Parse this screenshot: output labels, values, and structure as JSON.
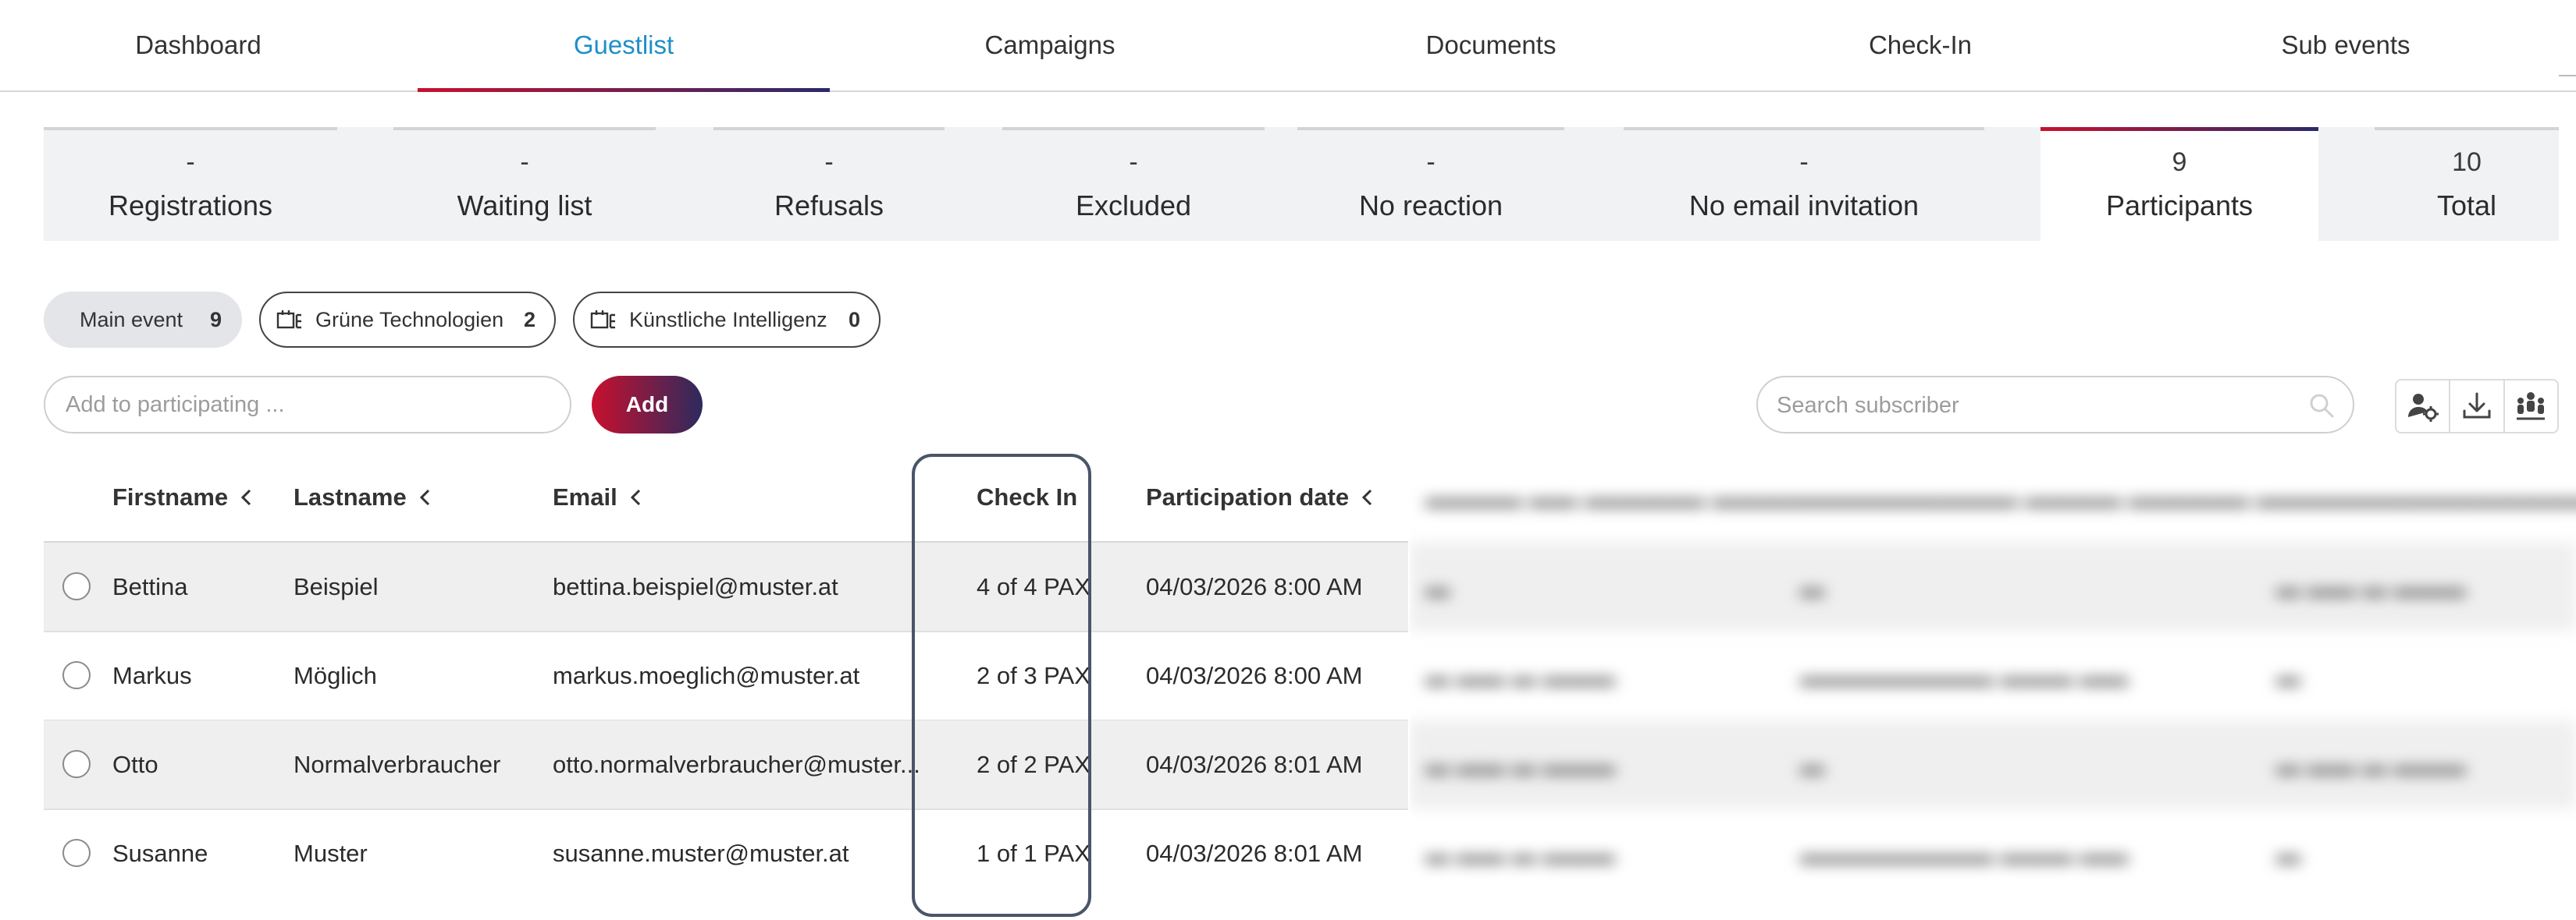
{
  "nav": {
    "tabs": [
      {
        "label": "Dashboard"
      },
      {
        "label": "Guestlist",
        "active": true
      },
      {
        "label": "Campaigns"
      },
      {
        "label": "Documents"
      },
      {
        "label": "Check-In"
      },
      {
        "label": "Sub events"
      }
    ]
  },
  "status_tabs": [
    {
      "count": "-",
      "label": "Registrations"
    },
    {
      "count": "-",
      "label": "Waiting list"
    },
    {
      "count": "-",
      "label": "Refusals"
    },
    {
      "count": "-",
      "label": "Excluded"
    },
    {
      "count": "-",
      "label": "No reaction"
    },
    {
      "count": "-",
      "label": "No email invitation"
    },
    {
      "count": "9",
      "label": "Participants",
      "active": true
    },
    {
      "count": "10",
      "label": "Total"
    }
  ],
  "event_filters": [
    {
      "label": "Main event",
      "count": "9",
      "icon": "none"
    },
    {
      "label": "Grüne Technologien",
      "count": "2",
      "icon": "sub-event-icon"
    },
    {
      "label": "Künstliche Intelligenz",
      "count": "0",
      "icon": "sub-event-icon"
    }
  ],
  "actions": {
    "add_placeholder": "Add to participating ...",
    "add_label": "Add",
    "search_placeholder": "Search subscriber",
    "tools": [
      "user-settings-icon",
      "download-icon",
      "group-icon"
    ]
  },
  "table": {
    "columns": [
      "Firstname",
      "Lastname",
      "Email",
      "Check In",
      "Participation date"
    ],
    "rows": [
      {
        "firstname": "Bettina",
        "lastname": "Beispiel",
        "email": "bettina.beispiel@muster.at",
        "checkin": "4 of 4 PAX",
        "date": "04/03/2026 8:00 AM"
      },
      {
        "firstname": "Markus",
        "lastname": "Möglich",
        "email": "markus.moeglich@muster.at",
        "checkin": "2 of 3 PAX",
        "date": "04/03/2026 8:00 AM"
      },
      {
        "firstname": "Otto",
        "lastname": "Normalverbraucher",
        "email": "otto.normalverbraucher@muster...",
        "checkin": "2 of 2 PAX",
        "date": "04/03/2026 8:01 AM"
      },
      {
        "firstname": "Susanne",
        "lastname": "Muster",
        "email": "susanne.muster@muster.at",
        "checkin": "1 of 1 PAX",
        "date": "04/03/2026 8:01 AM"
      }
    ]
  },
  "colors": {
    "accent_blue": "#1e8fc6",
    "brand_red": "#c8102e",
    "brand_navy": "#2a2a6a",
    "tab_bar_bg": "#f1f2f3",
    "highlight_border": "#4a5568"
  }
}
